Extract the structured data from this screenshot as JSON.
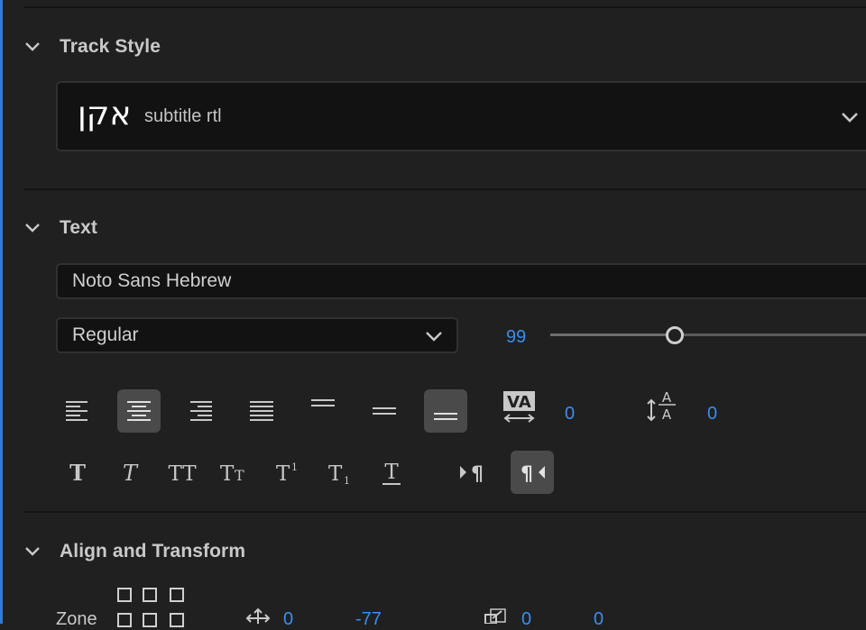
{
  "sections": {
    "track_style": {
      "title": "Track Style",
      "sample_glyph": "אקן",
      "selected_style": "subtitle rtl"
    },
    "text": {
      "title": "Text",
      "font_family": "Noto Sans Hebrew",
      "font_weight": "Regular",
      "font_size": "99",
      "font_size_slider": 0.37,
      "tracking": "0",
      "leading": "0",
      "alignment_buttons": [
        "align-left",
        "align-center",
        "align-right",
        "justify",
        "align-top",
        "align-middle",
        "align-bottom"
      ],
      "active_alignment": [
        "align-center",
        "align-bottom"
      ],
      "style_buttons": [
        "faux-bold",
        "faux-italic",
        "all-caps",
        "small-caps",
        "superscript",
        "subscript",
        "underline",
        "ltr",
        "rtl"
      ],
      "active_direction": "rtl"
    },
    "align_transform": {
      "title": "Align and Transform",
      "zone_label": "Zone",
      "position_x": "0",
      "position_y": "-77",
      "scale_x": "0",
      "scale_y": "0"
    }
  },
  "colors": {
    "background": "#202020",
    "accent": "#3a8ef0",
    "active_button": "#4a4a4a",
    "field_background": "#121212"
  }
}
